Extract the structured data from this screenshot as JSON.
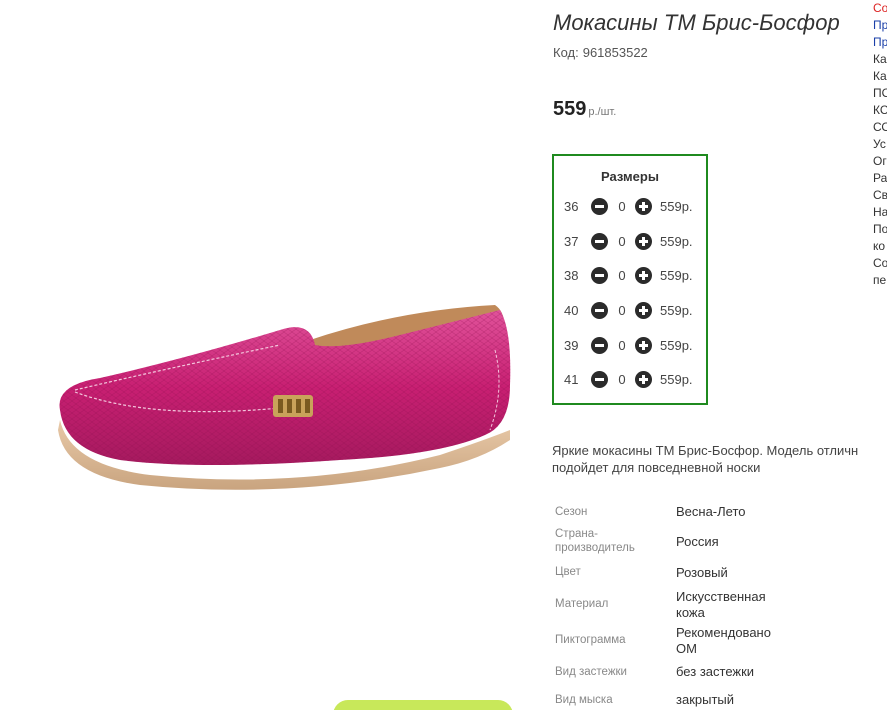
{
  "product": {
    "title": "Мокасины ТМ Брис-Босфор",
    "code_label": "Код:",
    "code_value": "961853522",
    "price_value": "559",
    "price_unit": "р./шт.",
    "description_line1": "Яркие мокасины ТМ Брис-Босфор. Модель отличн",
    "description_line2": "подойдет для повседневной носки"
  },
  "sizes": {
    "title": "Размеры",
    "rows": [
      {
        "size": "36",
        "qty": "0",
        "price": "559р."
      },
      {
        "size": "37",
        "qty": "0",
        "price": "559р."
      },
      {
        "size": "38",
        "qty": "0",
        "price": "559р."
      },
      {
        "size": "40",
        "qty": "0",
        "price": "559р."
      },
      {
        "size": "39",
        "qty": "0",
        "price": "559р."
      },
      {
        "size": "41",
        "qty": "0",
        "price": "559р."
      }
    ]
  },
  "specs": [
    {
      "label": "Сезон",
      "value": "Весна-Лето"
    },
    {
      "label": "Страна-\nпроизводитель",
      "value": "Россия"
    },
    {
      "label": "Цвет",
      "value": "Розовый"
    },
    {
      "label": "Материал",
      "value": "Искусственная\nкожа"
    },
    {
      "label": "Пиктограмма",
      "value": "Рекомендовано\nОМ"
    },
    {
      "label": "Вид застежки",
      "value": "без застежки"
    },
    {
      "label": "Вид мыска",
      "value": "закрытый"
    }
  ],
  "right_sidebar": [
    "Со",
    "Пр",
    "Пр",
    "Ка",
    "Ка",
    "ПО",
    "КС",
    "СО",
    "Ус",
    "Ог",
    "Ра",
    "Св",
    "На",
    "По",
    "ко",
    "Со",
    "пе"
  ],
  "colors": {
    "accent_border": "#1f8a1f",
    "button_dark": "#2b2b2b",
    "shoe_pink": "#d6287a",
    "cart_button": "#c8e85a"
  },
  "icons": {
    "minus": "minus-circle-icon",
    "plus": "plus-circle-icon"
  }
}
